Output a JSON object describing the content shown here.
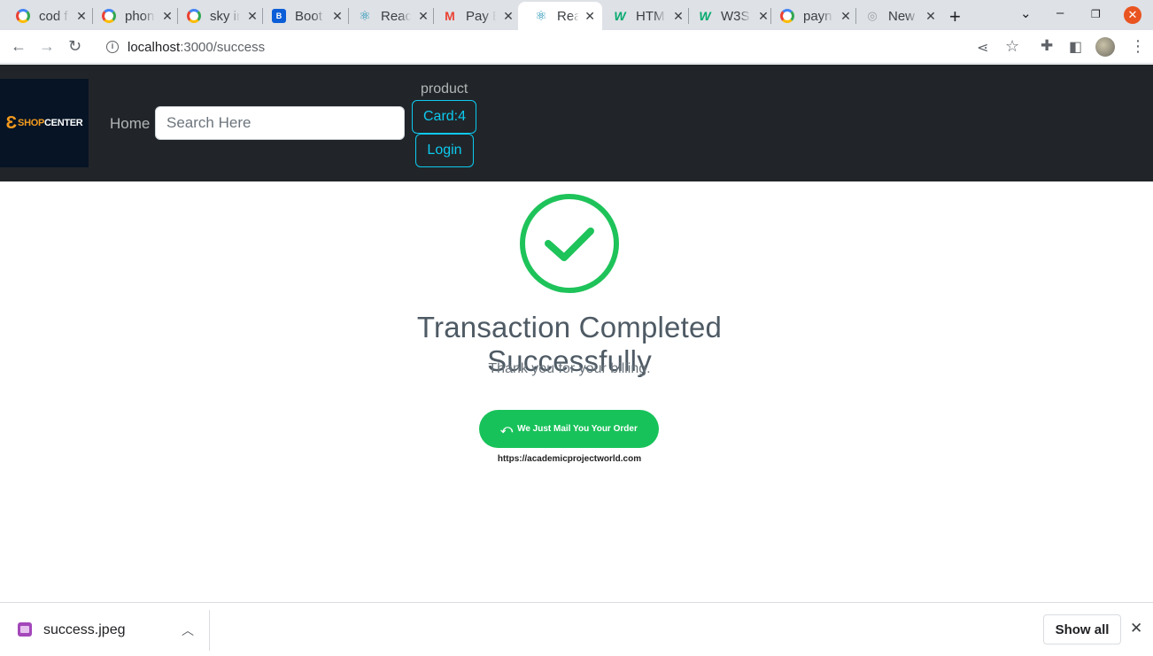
{
  "browser": {
    "tabs": [
      {
        "title": "cod f",
        "icon": "google-icon"
      },
      {
        "title": "phon",
        "icon": "google-icon"
      },
      {
        "title": "sky in",
        "icon": "google-icon"
      },
      {
        "title": "Boot",
        "icon": "bootstrap-icon"
      },
      {
        "title": "Reac",
        "icon": "react-icon"
      },
      {
        "title": "Pay E",
        "icon": "gmail-icon"
      },
      {
        "title": "Reac",
        "icon": "react-icon",
        "active": true
      },
      {
        "title": "HTM",
        "icon": "w3schools-icon"
      },
      {
        "title": "W3S",
        "icon": "w3schools-icon"
      },
      {
        "title": "payn",
        "icon": "google-icon"
      },
      {
        "title": "New",
        "icon": "globe-icon"
      }
    ],
    "url_host": "localhost",
    "url_path": ":3000/success"
  },
  "navbar": {
    "logo_accent": "SHOP",
    "logo_text": "CENTER",
    "home_label": "Home",
    "search_placeholder": "Search Here",
    "product_label": "product",
    "card_label": "Card:4",
    "login_label": "Login"
  },
  "success": {
    "title": "Transaction Completed Successfully",
    "subtitle": "Thank you for your billing.",
    "button_label": "We Just Mail You Your Order",
    "footer_url": "https://academicprojectworld.com",
    "check_color": "#1ec35a"
  },
  "downloads": {
    "file_name": "success.jpeg",
    "show_all_label": "Show all"
  }
}
